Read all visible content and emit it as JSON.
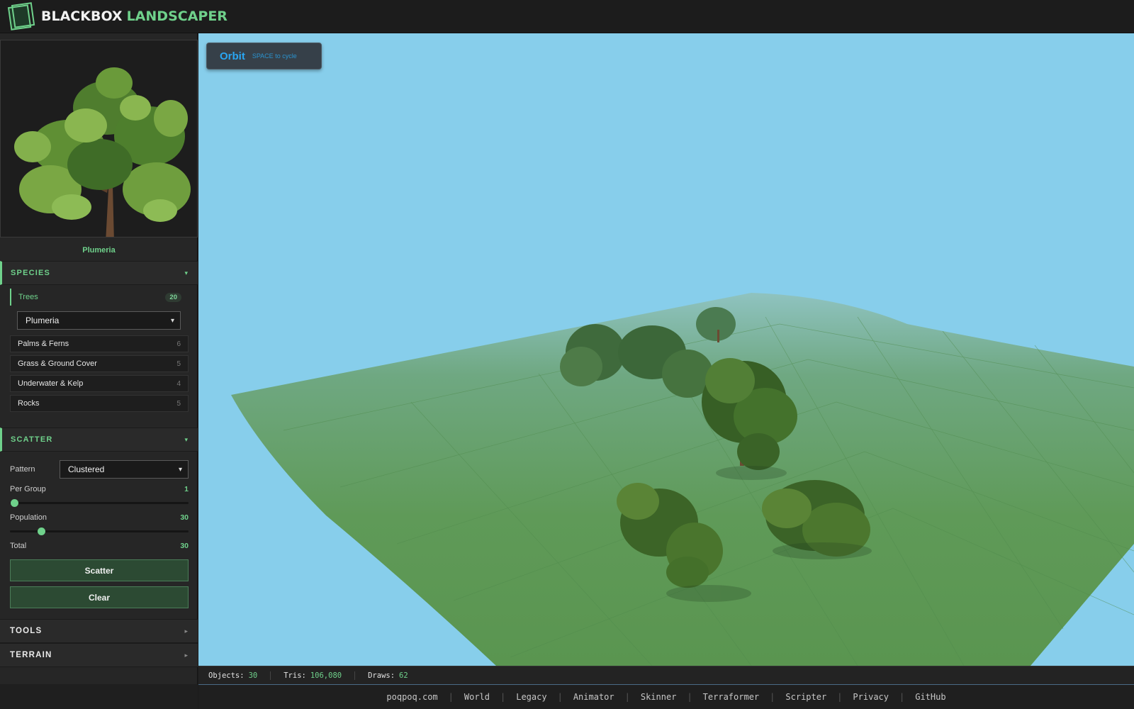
{
  "header": {
    "brand_part1": "BLACKBOX",
    "brand_part2": "LANDSCAPER",
    "logo_icon": "book-frame-icon",
    "accent": "#6fd18b"
  },
  "preview": {
    "name": "Plumeria"
  },
  "species": {
    "title": "SPECIES",
    "arrow": "▾",
    "active_category": {
      "label": "Trees",
      "count": "20"
    },
    "selected_species": "Plumeria",
    "select_chevron": "⌄",
    "categories": [
      {
        "label": "Palms & Ferns",
        "count": "6"
      },
      {
        "label": "Grass & Ground Cover",
        "count": "5"
      },
      {
        "label": "Underwater & Kelp",
        "count": "4"
      },
      {
        "label": "Rocks",
        "count": "5"
      }
    ]
  },
  "scatter": {
    "title": "SCATTER",
    "arrow": "▾",
    "pattern_label": "Pattern",
    "pattern_value": "Clustered",
    "per_group_label": "Per Group",
    "per_group_value": "1",
    "per_group_fraction": 0.0,
    "population_label": "Population",
    "population_value": "30",
    "population_fraction": 0.16,
    "total_label": "Total",
    "total_value": "30",
    "scatter_button": "Scatter",
    "clear_button": "Clear"
  },
  "tools": {
    "title": "TOOLS",
    "arrow": "▸"
  },
  "terrain": {
    "title": "TERRAIN",
    "arrow": "▸"
  },
  "viewport": {
    "mode": "Orbit",
    "mode_hint": "SPACE to cycle",
    "sky_color": "#87ceeb",
    "ground_color": "#5e9a56"
  },
  "stats": {
    "objects_label": "Objects:",
    "objects_value": "30",
    "tris_label": "Tris:",
    "tris_value": "106,080",
    "draws_label": "Draws:",
    "draws_value": "62"
  },
  "footer": {
    "links": [
      "poqpoq.com",
      "World",
      "Legacy",
      "Animator",
      "Skinner",
      "Terraformer",
      "Scripter",
      "Privacy",
      "GitHub"
    ],
    "separator": "|"
  }
}
